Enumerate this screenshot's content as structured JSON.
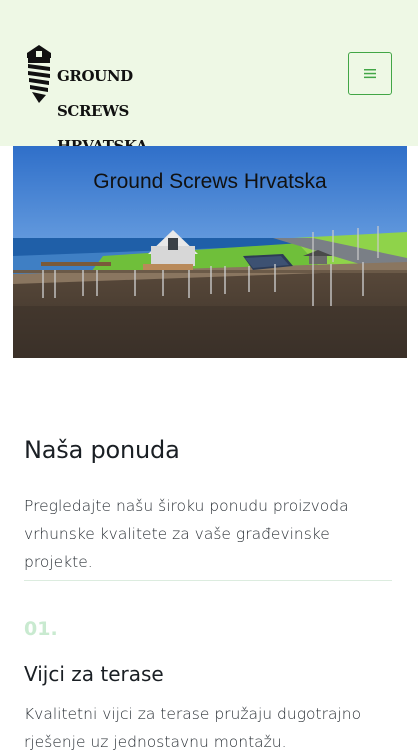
{
  "header": {
    "logo_lines": [
      "GROUND",
      "SCREWS",
      "HRVATSKA"
    ],
    "menu_icon": "hamburger-icon",
    "bg_color": "#eef8e5",
    "accent_color": "#42a646"
  },
  "hero": {
    "title": "Ground Screws Hrvatska"
  },
  "offer": {
    "title": "Naša ponuda",
    "description": "Pregledajte našu široku ponudu proizvoda vrhunske kvalitete za vaše građevinske projekte."
  },
  "items": [
    {
      "number": "01.",
      "title": "Vijci za terase",
      "description": "Kvalitetni vijci za terase pružaju dugotrajno rješenje uz jednostavnu montažu."
    }
  ]
}
